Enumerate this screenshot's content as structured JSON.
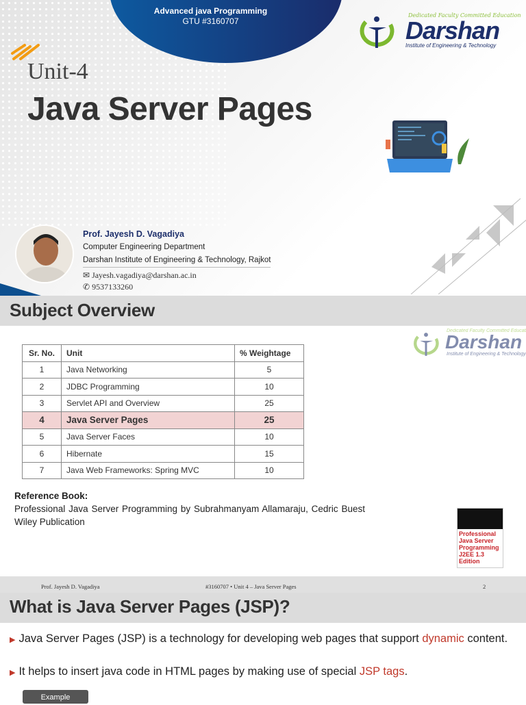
{
  "slide1": {
    "course": "Advanced java Programming",
    "code": "GTU #3160707",
    "logo": {
      "tagline": "Dedicated Faculty Committed Education",
      "name": "Darshan",
      "subtitle": "Institute of Engineering & Technology"
    },
    "unit": "Unit-4",
    "title": "Java Server Pages",
    "professor": {
      "name": "Prof. Jayesh D. Vagadiya",
      "department": "Computer Engineering Department",
      "institute": "Darshan Institute of Engineering & Technology, Rajkot",
      "email": "Jayesh.vagadiya@darshan.ac.in",
      "phone": "9537133260"
    }
  },
  "slide2": {
    "heading": "Subject Overview",
    "table": {
      "headers": [
        "Sr. No.",
        "Unit",
        "% Weightage"
      ],
      "rows": [
        [
          "1",
          "Java Networking",
          "5"
        ],
        [
          "2",
          "JDBC Programming",
          "10"
        ],
        [
          "3",
          "Servlet API and Overview",
          "25"
        ],
        [
          "4",
          "Java Server Pages",
          "25"
        ],
        [
          "5",
          "Java Server Faces",
          "10"
        ],
        [
          "6",
          "Hibernate",
          "15"
        ],
        [
          "7",
          "Java Web Frameworks: Spring MVC",
          "10"
        ]
      ],
      "highlight_row": 3
    },
    "reference_label": "Reference Book:",
    "reference_text": "Professional Java Server Programming by Subrahmanyam Allamaraju, Cedric Buest Wiley Publication",
    "book_cover_title": "Professional Java Server Programming J2EE 1.3 Edition",
    "footer": {
      "author": "Prof. Jayesh D. Vagadiya",
      "center": "#3160707  •  Unit 4 – Java Server Pages",
      "page": "2"
    }
  },
  "slide3": {
    "heading": "What is Java Server Pages (JSP)?",
    "bullets": [
      {
        "before": "Java Server Pages (JSP) is a technology for developing web pages that support ",
        "highlight": "dynamic",
        "after": " content."
      },
      {
        "before": "It helps to insert java code in HTML pages by making use of special ",
        "highlight": "JSP tags",
        "after": "."
      }
    ],
    "button": "Example"
  },
  "colors": {
    "navy": "#1d2f6b",
    "accent_red": "#c0392b",
    "highlight_row": "#f2d3d3",
    "banner": "#dcdcdc"
  }
}
